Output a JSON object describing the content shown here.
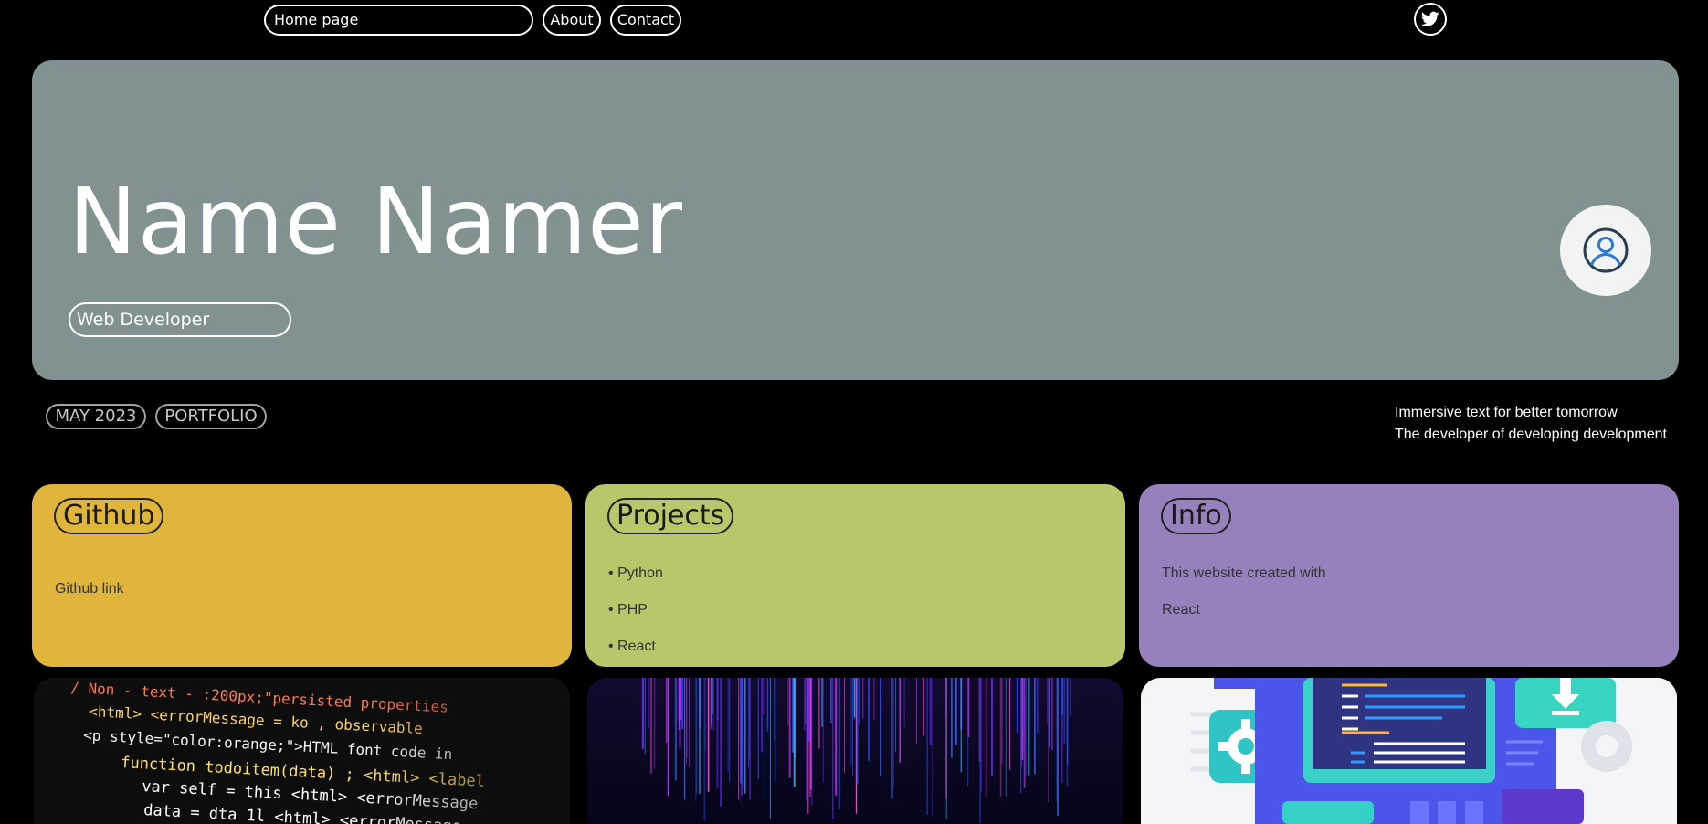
{
  "nav": {
    "home_label": "Home page",
    "about_label": "About",
    "contact_label": "Contact",
    "social_icon": "twitter-icon"
  },
  "hero": {
    "name": "Name Namer",
    "role": "Web Developer",
    "avatar_icon": "user-avatar-icon",
    "background": "#829293"
  },
  "tags": {
    "date": "MAY 2023",
    "category": "PORTFOLIO"
  },
  "tagline": {
    "line1": "Immersive text for better tomorrow",
    "line2": "The developer of developing development"
  },
  "cards": {
    "github": {
      "title": "Github",
      "link": "Github link",
      "color": "#dfb53c"
    },
    "projects": {
      "title": "Projects",
      "items": [
        "• Python",
        "• PHP",
        "• React"
      ],
      "color": "#bac66c"
    },
    "info": {
      "title": "Info",
      "line1": "This website created with",
      "line2": "React",
      "color": "#9681bc"
    }
  },
  "tiles": {
    "code_lines": [
      "/ Non - text - :200px;\"persisted properties",
      "<html> <errorMessage = ko , observable",
      "<p style=\"color:orange;\">HTML font code in",
      "function todoitem(data) ; <html> <label",
      "var self = this <html> <errorMessage",
      "data = dta 1l <html> <errorMessage"
    ]
  }
}
